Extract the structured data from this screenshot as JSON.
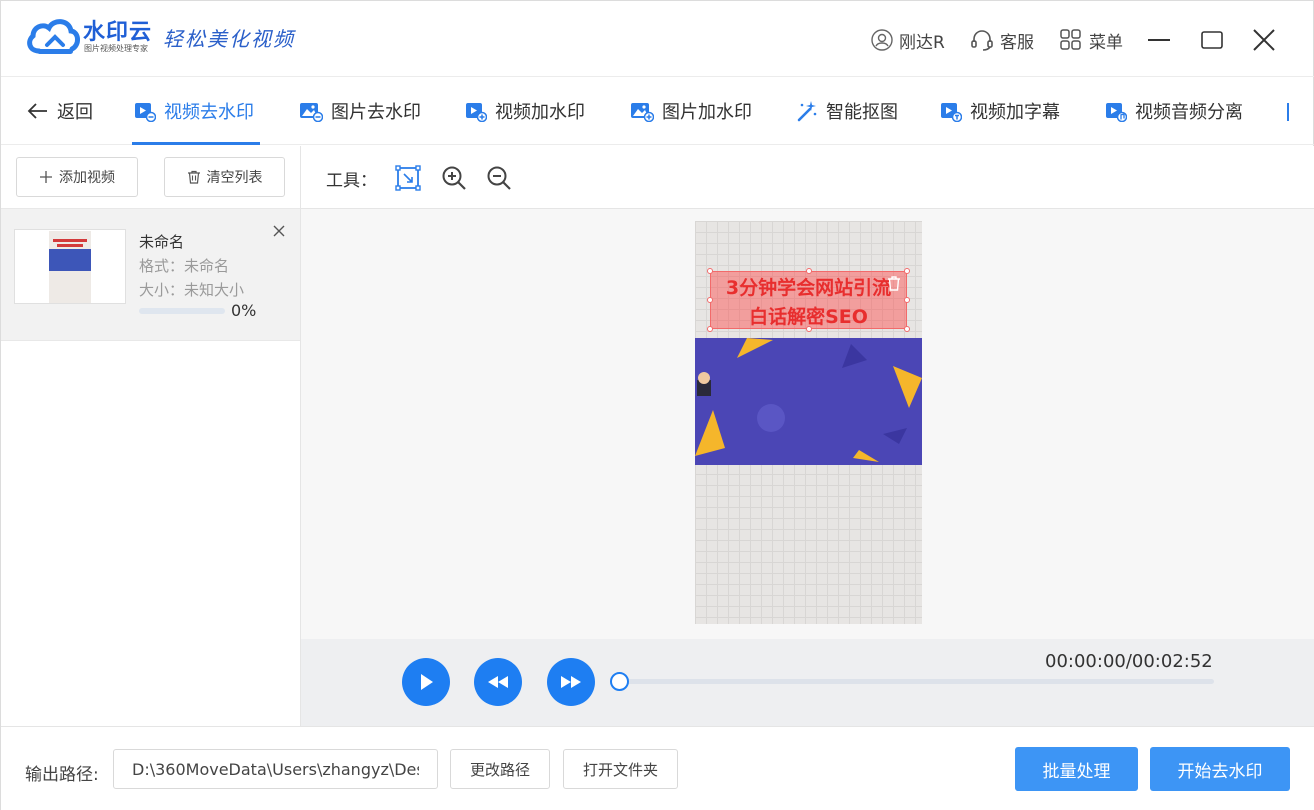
{
  "app": {
    "brand_name": "水印云",
    "brand_subtitle": "图片视频处理专家",
    "slogan": "轻松美化视频"
  },
  "titlebar": {
    "user_name": "刚达R",
    "support_label": "客服",
    "menu_label": "菜单"
  },
  "nav": {
    "back_label": "返回",
    "tabs": [
      {
        "label": "视频去水印",
        "icon": "video-erase-icon"
      },
      {
        "label": "图片去水印",
        "icon": "image-erase-icon"
      },
      {
        "label": "视频加水印",
        "icon": "video-add-icon"
      },
      {
        "label": "图片加水印",
        "icon": "image-add-icon"
      },
      {
        "label": "智能抠图",
        "icon": "magic-wand-icon"
      },
      {
        "label": "视频加字幕",
        "icon": "video-subtitle-icon"
      },
      {
        "label": "视频音频分离",
        "icon": "video-audio-icon"
      }
    ],
    "active_tab": "视频去水印"
  },
  "left_panel": {
    "add_video_label": "添加视频",
    "clear_list_label": "清空列表",
    "files": [
      {
        "name": "未命名",
        "format_line": "格式：未命名",
        "size_line": "大小：未知大小",
        "progress_text": "0%",
        "progress": 0
      }
    ]
  },
  "toolbar": {
    "tools_label": "工具："
  },
  "preview": {
    "video_title_line1": "3分钟学会网站引流",
    "video_title_line2": "白话解密SEO"
  },
  "player": {
    "time_display": "00:00:00/00:02:52",
    "position": 0
  },
  "bottom": {
    "output_label": "输出路径:",
    "output_path": "D:\\360MoveData\\Users\\zhangyz\\Des",
    "change_path_label": "更改路径",
    "open_folder_label": "打开文件夹",
    "batch_label": "批量处理",
    "start_label": "开始去水印"
  },
  "colors": {
    "accent": "#2b7de9",
    "player_button": "#1e7ef2",
    "primary_button": "#3d95f5",
    "selection_fill": "#ff4646"
  }
}
